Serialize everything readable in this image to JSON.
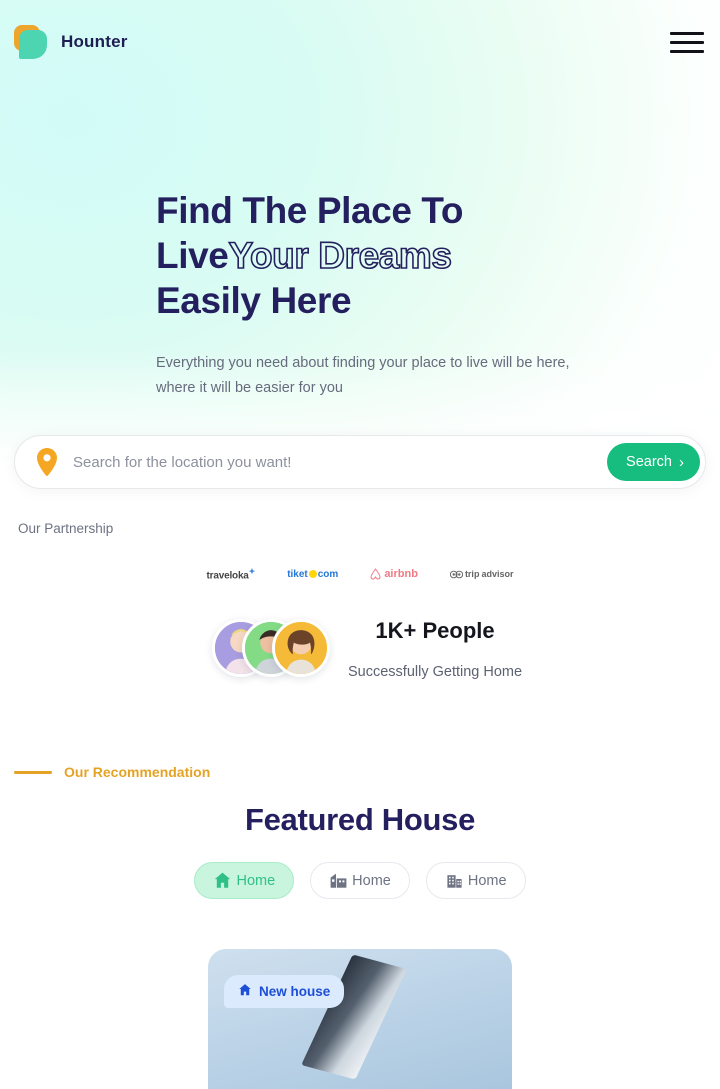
{
  "brand": {
    "name": "Hounter",
    "logo_icon": "shield-logo-icon",
    "accent_green": "#4dd5b2",
    "accent_orange": "#eda52c"
  },
  "nav": {
    "menu_icon": "hamburger-menu-icon"
  },
  "hero": {
    "headline_line1": "Find The Place To",
    "headline_line2_solid": "Live",
    "headline_line2_outline": "Your Dreams",
    "headline_line3": "Easily Here",
    "subtitle": "Everything you need about finding your place to live will be here, where it will be easier for you",
    "heading_color": "#241f5e"
  },
  "search": {
    "placeholder": "Search for the location you want!",
    "value": "",
    "button_label": "Search",
    "button_color": "#17bd7f",
    "pin_icon": "map-pin-icon",
    "chevron_icon": "chevron-right-icon"
  },
  "partnership": {
    "label": "Our Partnership",
    "logos": [
      {
        "name": "traveloka",
        "text": "traveloka",
        "icon": "traveloka-logo-icon"
      },
      {
        "name": "tiket-com",
        "text_a": "tiket",
        "text_b": "com",
        "icon": "tiket-logo-icon"
      },
      {
        "name": "airbnb",
        "text": "airbnb",
        "icon": "airbnb-logo-icon"
      },
      {
        "name": "tripadvisor",
        "text_a": "trip",
        "text_b": "advisor",
        "icon": "tripadvisor-logo-icon"
      }
    ]
  },
  "people": {
    "count": "1K+ People",
    "caption": "Successfully Getting Home",
    "avatars": [
      "avatar-person-1",
      "avatar-person-2",
      "avatar-person-3"
    ]
  },
  "recommendation": {
    "eyebrow": "Our Recommendation",
    "eyebrow_color": "#e5a325",
    "title": "Featured House",
    "tabs": [
      {
        "label": "Home",
        "icon": "house-icon",
        "active": true
      },
      {
        "label": "Home",
        "icon": "townhouse-icon",
        "active": false
      },
      {
        "label": "Home",
        "icon": "apartment-icon",
        "active": false
      }
    ]
  },
  "featured_card": {
    "badge_label": "New house",
    "badge_icon": "house-icon",
    "badge_color": "#1d4ed8"
  }
}
